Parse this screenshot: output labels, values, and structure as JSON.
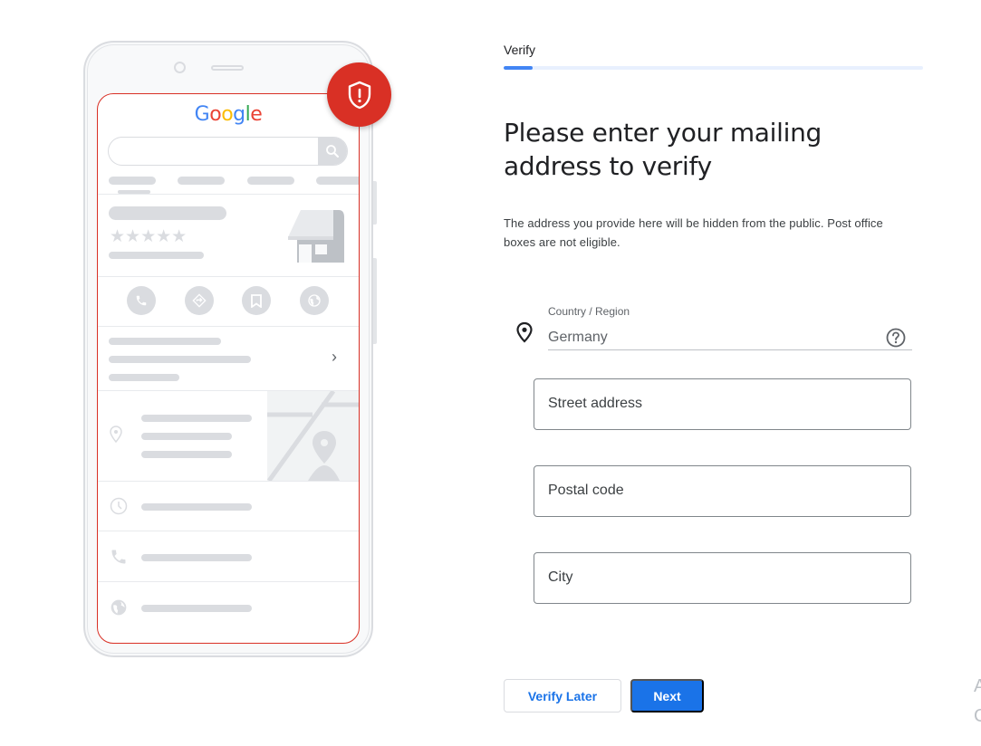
{
  "illustration": {
    "logo_letters": [
      {
        "char": "G",
        "color": "#4285f4"
      },
      {
        "char": "o",
        "color": "#ea4335"
      },
      {
        "char": "o",
        "color": "#fbbc05"
      },
      {
        "char": "g",
        "color": "#4285f4"
      },
      {
        "char": "l",
        "color": "#34a853"
      },
      {
        "char": "e",
        "color": "#ea4335"
      }
    ],
    "stars": "★★★★★",
    "chevron": "›",
    "badge_icon": "shield-alert-icon",
    "badge_color": "#d93025",
    "action_icons": [
      "phone-icon",
      "directions-icon",
      "bookmark-icon",
      "globe-icon"
    ],
    "info_row_icons": [
      "location-pin-icon",
      "clock-icon",
      "phone-icon",
      "globe-icon"
    ]
  },
  "step": {
    "label": "Verify",
    "progress": 0.07
  },
  "form": {
    "title": "Please enter your mailing address to verify",
    "description": "The address you provide here will be hidden from the public. Post office boxes are not eligible.",
    "country": {
      "label": "Country / Region",
      "value": "Germany"
    },
    "fields": {
      "street": {
        "placeholder": "Street address"
      },
      "postal": {
        "placeholder": "Postal code"
      },
      "city": {
        "placeholder": "City"
      }
    },
    "buttons": {
      "verify_later": "Verify Later",
      "next": "Next"
    }
  },
  "edge": {
    "line1": "A",
    "line2": "C"
  },
  "colors": {
    "accent": "#1a73e8",
    "progress": "#4285f4",
    "alert": "#d93025"
  }
}
